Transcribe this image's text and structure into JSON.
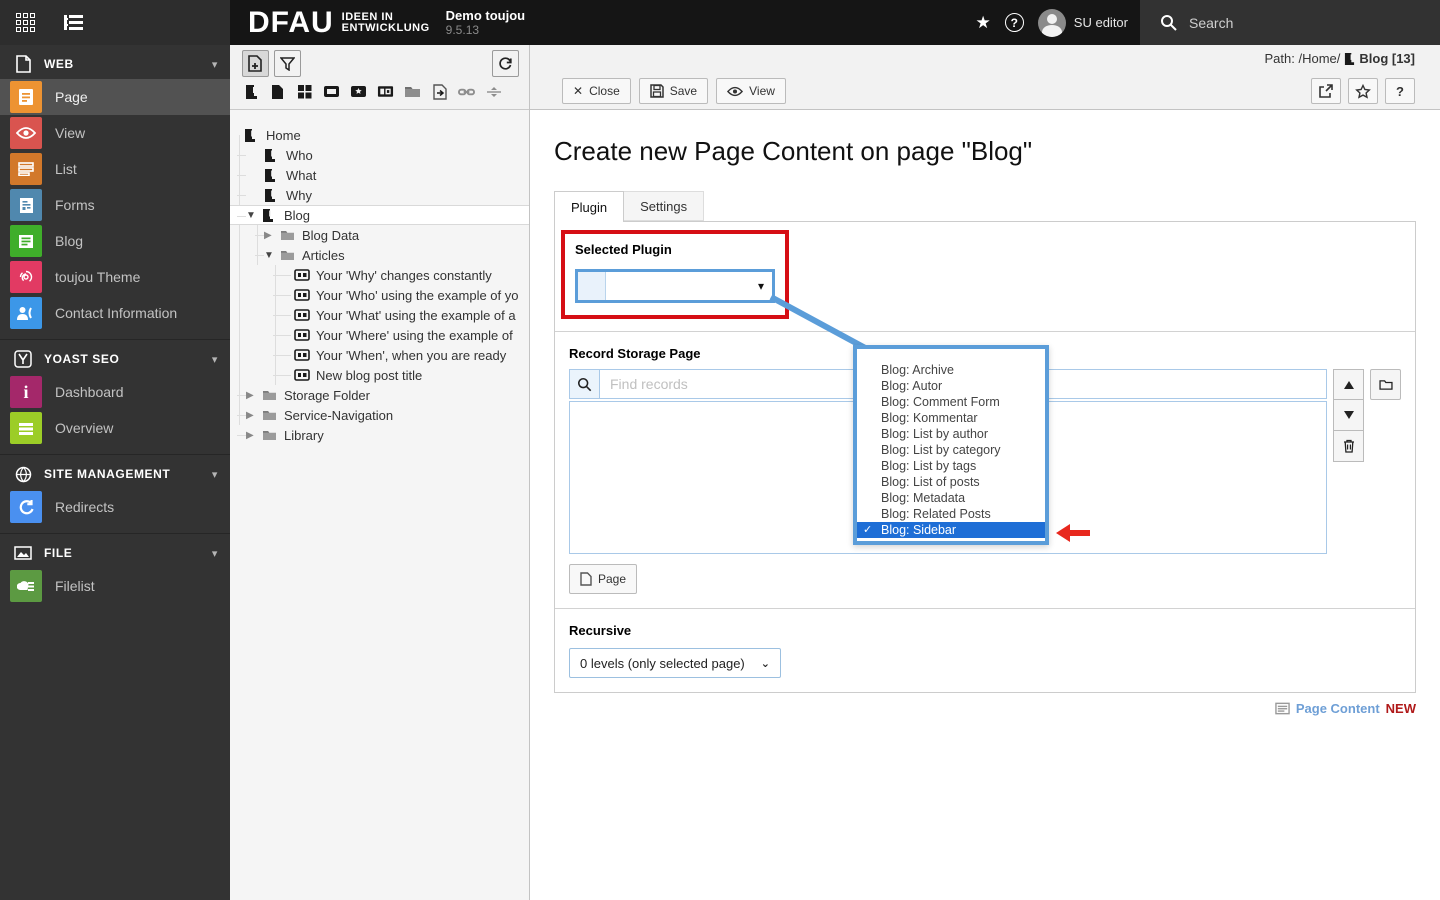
{
  "colors": {
    "annotation_red": "#d60e15",
    "annotation_blue": "#5b9dd9",
    "dropdown_selected_blue": "#1e6ed6",
    "footer_link_blue": "#6e9fd6",
    "footer_new_red": "#b01919"
  },
  "topbar": {
    "brand": "DFAU",
    "brand_sub1": "IDEEN IN",
    "brand_sub2": "ENTWICKLUNG",
    "site_name": "Demo toujou",
    "version": "9.5.13",
    "user": "SU editor",
    "search_label": "Search"
  },
  "sidebar": {
    "sections": [
      {
        "label": "WEB",
        "items": [
          {
            "label": "Page",
            "color": "#ed9332"
          },
          {
            "label": "View",
            "color": "#d9544f"
          },
          {
            "label": "List",
            "color": "#d2782a"
          },
          {
            "label": "Forms",
            "color": "#5088ae"
          },
          {
            "label": "Blog",
            "color": "#3fae2a"
          },
          {
            "label": "toujou Theme",
            "color": "#e23a63"
          },
          {
            "label": "Contact Information",
            "color": "#3c97e8"
          }
        ]
      },
      {
        "label": "YOAST SEO",
        "items": [
          {
            "label": "Dashboard",
            "color": "#a4286a"
          },
          {
            "label": "Overview",
            "color": "#9ccd27"
          }
        ]
      },
      {
        "label": "SITE MANAGEMENT",
        "items": [
          {
            "label": "Redirects",
            "color": "#4a90f0"
          }
        ]
      },
      {
        "label": "FILE",
        "items": [
          {
            "label": "Filelist",
            "color": "#5c9a42"
          }
        ]
      }
    ]
  },
  "tree": {
    "items": [
      {
        "label": "Home"
      },
      {
        "label": "Who"
      },
      {
        "label": "What"
      },
      {
        "label": "Why"
      },
      {
        "label": "Blog"
      },
      {
        "label": "Blog Data"
      },
      {
        "label": "Articles"
      },
      {
        "label": "Your 'Why' changes constantly"
      },
      {
        "label": "Your 'Who' using the example of yo"
      },
      {
        "label": "Your 'What' using the example of a"
      },
      {
        "label": "Your 'Where' using the example of "
      },
      {
        "label": "Your 'When', when you are ready"
      },
      {
        "label": "New blog post title"
      },
      {
        "label": "Storage Folder"
      },
      {
        "label": "Service-Navigation"
      },
      {
        "label": "Library"
      }
    ]
  },
  "docheader": {
    "path_label": "Path: /Home/",
    "path_page": "Blog [13]",
    "close_label": "Close",
    "save_label": "Save",
    "view_label": "View",
    "help_label": "?"
  },
  "content": {
    "title": "Create new Page Content on page \"Blog\"",
    "tabs": [
      {
        "label": "Plugin"
      },
      {
        "label": "Settings"
      }
    ],
    "selected_plugin_label": "Selected Plugin",
    "record_storage_label": "Record Storage Page",
    "find_placeholder": "Find records",
    "page_button_label": "Page",
    "recursive_label": "Recursive",
    "recursive_value": "0 levels (only selected page)",
    "footer_link": "Page Content",
    "footer_badge": "NEW"
  },
  "plugin_dropdown": {
    "options": [
      "Blog: Archive",
      "Blog: Autor",
      "Blog: Comment Form",
      "Blog: Kommentar",
      "Blog: List by author",
      "Blog: List by category",
      "Blog: List by tags",
      "Blog: List of posts",
      "Blog: Metadata",
      "Blog: Related Posts",
      "Blog: Sidebar"
    ],
    "selected": "Blog: Sidebar",
    "checkmark": "✓"
  }
}
